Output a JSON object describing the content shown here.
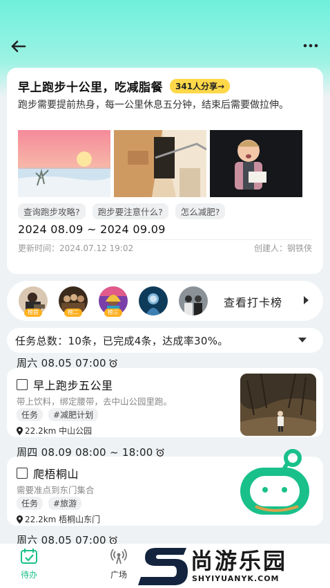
{
  "header": {
    "back_icon": "arrow-left-icon",
    "more_icon": "more-dots-icon"
  },
  "plan": {
    "title": "早上跑步十公里，吃减脂餐",
    "share_badge": "341人分享→",
    "description": "跑步需要提前热身，每一公里休息五分钟，结束后需要做拉伸。",
    "tags": [
      "查询跑步攻略?",
      "跑步要注意什么?",
      "怎么减肥?"
    ],
    "date_range": "2024 08.09 ~ 2024 09.09",
    "updated": "更新时间：2024.07.12  19:02",
    "creator": "创建人：钢铁侠"
  },
  "rank": {
    "avatars": [
      {
        "label": "榜首"
      },
      {
        "label": "榜二"
      },
      {
        "label": "榜三"
      },
      {
        "label": ""
      },
      {
        "label": ""
      }
    ],
    "link_label": "查看打卡榜"
  },
  "stats": {
    "text": "任务总数：10条，已完成4条，达成率30%。"
  },
  "tasks": [
    {
      "group": "周六 08.05 07:00",
      "title": "早上跑步五公里",
      "desc": "带上饮料，绑定腰带，去中山公园里跑。",
      "tags": [
        "任务",
        "#减肥计划"
      ],
      "location": "22.2km 中山公园"
    },
    {
      "group": "周四 08.09 08:00 ~ 18:00",
      "title": "爬梧桐山",
      "desc": "需要准点到东门集合",
      "tags": [
        "任务",
        "#旅游"
      ],
      "location": "22.2km 梧桐山东门"
    },
    {
      "group": "周六 08.05 07:00"
    }
  ],
  "tabbar": {
    "tabs": [
      {
        "label": "待办",
        "icon": "calendar-check-icon",
        "color": "#19c08a"
      },
      {
        "label": "广场",
        "icon": "broadcast-icon",
        "color": "#555555"
      }
    ]
  },
  "watermark": {
    "cn": "尚游乐园",
    "en": "SHYIYUANYK.COM"
  },
  "colors": {
    "accent": "#19c08a",
    "badge": "#ffd84a",
    "rank_label": "#ffb020"
  }
}
